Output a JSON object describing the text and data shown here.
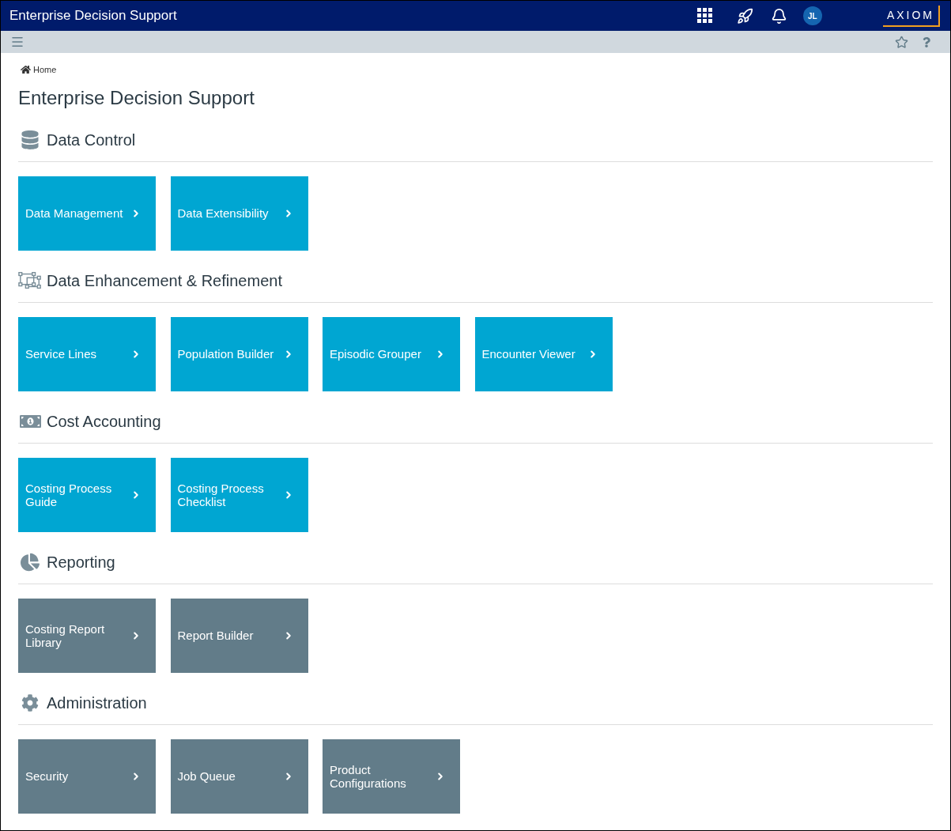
{
  "top_bar": {
    "title": "Enterprise Decision Support",
    "avatar_initials": "JL",
    "logo": "AXIOM"
  },
  "breadcrumb": "Home",
  "page_title": "Enterprise Decision Support",
  "sections": [
    {
      "title": "Data Control",
      "tiles": [
        {
          "label": "Data Management",
          "color": "#00a6d2"
        },
        {
          "label": "Data Extensibility",
          "color": "#00a6d2"
        }
      ]
    },
    {
      "title": "Data Enhancement & Refinement",
      "tiles": [
        {
          "label": "Service Lines",
          "color": "#00a6d2"
        },
        {
          "label": "Population Builder",
          "color": "#00a6d2"
        },
        {
          "label": "Episodic Grouper",
          "color": "#00a6d2"
        },
        {
          "label": "Encounter Viewer",
          "color": "#00a6d2"
        }
      ]
    },
    {
      "title": "Cost Accounting",
      "tiles": [
        {
          "label": "Costing Process Guide",
          "color": "#00a6d2"
        },
        {
          "label": "Costing Process Checklist",
          "color": "#00a6d2"
        }
      ]
    },
    {
      "title": "Reporting",
      "tiles": [
        {
          "label": "Costing Report Library",
          "color": "#627c89"
        },
        {
          "label": "Report Builder",
          "color": "#627c89"
        }
      ]
    },
    {
      "title": "Administration",
      "tiles": [
        {
          "label": "Security",
          "color": "#627c89"
        },
        {
          "label": "Job Queue",
          "color": "#627c89"
        },
        {
          "label": "Product Configurations",
          "color": "#627c89"
        }
      ]
    }
  ]
}
